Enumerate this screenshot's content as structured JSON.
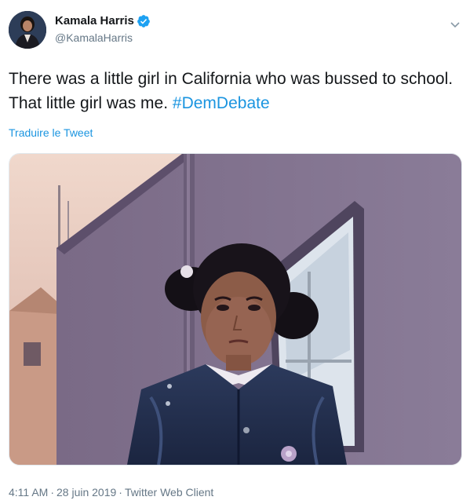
{
  "author": {
    "display_name": "Kamala Harris",
    "handle": "@KamalaHarris",
    "verified": true,
    "verified_icon": "verified-badge-icon"
  },
  "tweet": {
    "text_plain": "There was a little girl in California who was bussed to school. That little girl was me. ",
    "hashtag": "#DemDebate"
  },
  "translate_label": "Traduire le Tweet",
  "meta": {
    "time": "4:11 AM",
    "separator": "·",
    "date": "28 juin 2019",
    "client": "Twitter Web Client"
  },
  "colors": {
    "link": "#1b95e0",
    "secondary_text": "#657786",
    "primary_text": "#14171a",
    "verified_badge": "#1da1f2"
  },
  "icons": {
    "menu": "chevron-down-icon",
    "verified": "verified-badge-icon"
  }
}
